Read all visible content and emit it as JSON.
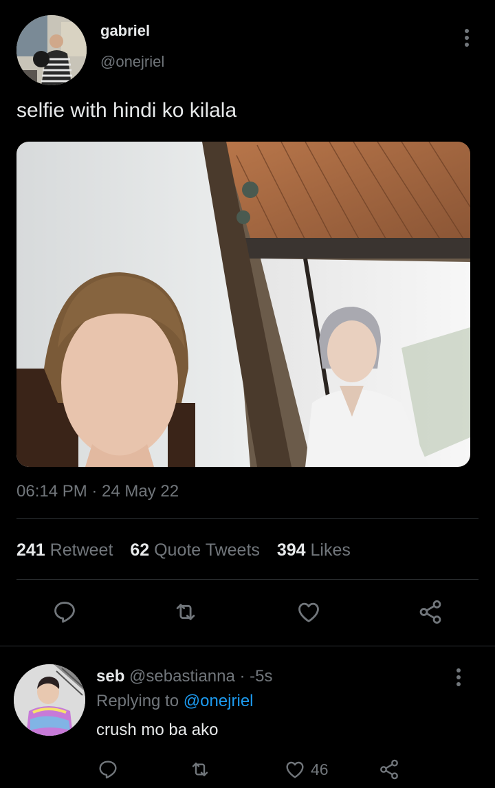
{
  "tweet": {
    "display_name": "gabriel",
    "handle": "@onejriel",
    "text": "selfie with hindi ko kilala",
    "timestamp": "06:14 PM · 24 May 22",
    "stats": {
      "retweets_count": "241",
      "retweets_label": "Retweet",
      "quotes_count": "62",
      "quotes_label": "Quote Tweets",
      "likes_count": "394",
      "likes_label": "Likes"
    }
  },
  "reply": {
    "display_name": "seb",
    "handle": "@sebastianna",
    "time": "· -5s",
    "replying_prefix": "Replying to",
    "replying_to": "@onejriel",
    "text": "crush mo ba ako",
    "likes_count": "46"
  },
  "colors": {
    "background": "#000000",
    "text": "#e7e9ea",
    "muted": "#71767b",
    "link": "#1d9bf0",
    "divider": "#2f3336"
  },
  "icons": [
    "more-vertical-icon",
    "reply-icon",
    "retweet-icon",
    "like-icon",
    "share-icon"
  ]
}
